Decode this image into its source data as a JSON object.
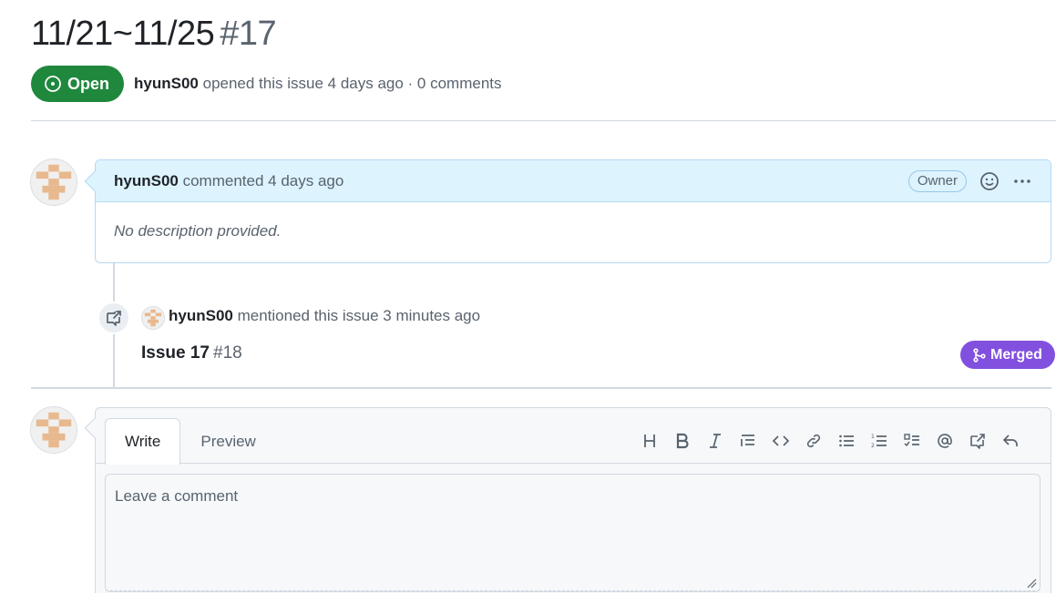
{
  "issue": {
    "title": "11/21~11/25",
    "number": "#17",
    "state": "Open",
    "author": "hyunS00",
    "meta": "opened this issue 4 days ago · 0 comments"
  },
  "comment": {
    "author": "hyunS00",
    "action": "commented 4 days ago",
    "role_badge": "Owner",
    "body": "No description provided."
  },
  "mention_event": {
    "author": "hyunS00",
    "action": "mentioned this issue 3 minutes ago",
    "ref_title": "Issue 17",
    "ref_number": "#18",
    "ref_state": "Merged"
  },
  "editor": {
    "tabs": [
      {
        "label": "Write",
        "active": true
      },
      {
        "label": "Preview",
        "active": false
      }
    ],
    "placeholder": "Leave a comment",
    "toolbar": [
      "heading",
      "bold",
      "italic",
      "quote",
      "code",
      "link",
      "unordered-list",
      "ordered-list",
      "task-list",
      "mention",
      "reference",
      "saved-reply"
    ]
  },
  "colors": {
    "open_green": "#1f883d",
    "merged_purple": "#8250df",
    "comment_header_bg": "#ddf4ff",
    "avatar_tan": "#e8b98f"
  }
}
